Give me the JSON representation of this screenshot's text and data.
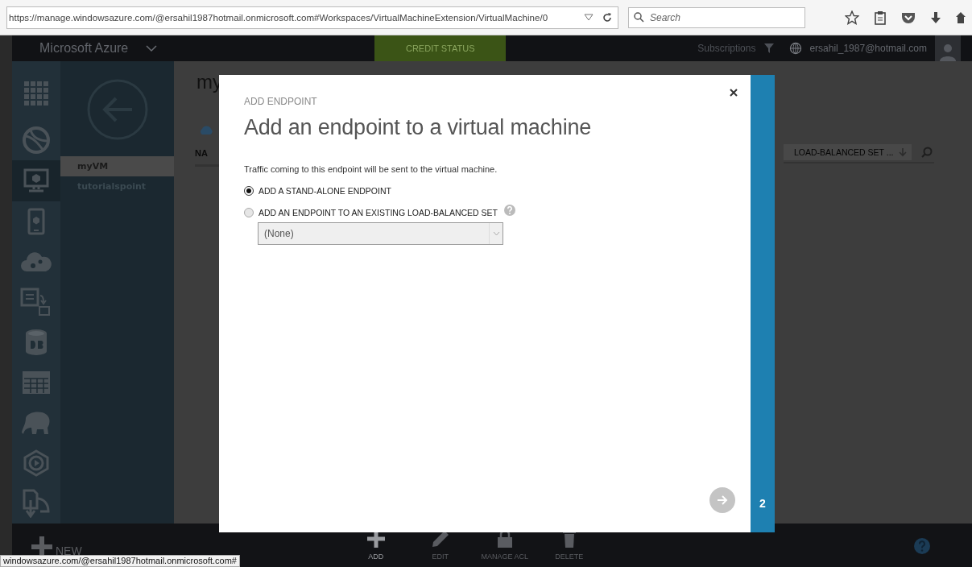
{
  "browser": {
    "url": "https://manage.windowsazure.com/@ersahil1987hotmail.onmicrosoft.com#Workspaces/VirtualMachineExtension/VirtualMachine/0",
    "search": {
      "placeholder": "Search"
    },
    "status_url": "windowsazure.com/@ersahil1987hotmail.onmicrosoft.com#"
  },
  "header": {
    "brand": "Microsoft Azure",
    "credit_status": "CREDIT STATUS",
    "subscriptions": "Subscriptions",
    "user": "ersahil_1987@hotmail.com"
  },
  "nav_rail": {
    "items": [
      {
        "kind": "grid",
        "selected": false
      },
      {
        "kind": "globe",
        "selected": false
      },
      {
        "kind": "monitor",
        "selected": true
      },
      {
        "kind": "mobile",
        "selected": false
      },
      {
        "kind": "cloud",
        "selected": false
      },
      {
        "kind": "document",
        "selected": false
      },
      {
        "kind": "database",
        "selected": false
      },
      {
        "kind": "table",
        "selected": false
      },
      {
        "kind": "elephant",
        "selected": false
      },
      {
        "kind": "media",
        "selected": false
      },
      {
        "kind": "import",
        "selected": false
      }
    ]
  },
  "nav_list": {
    "items": [
      {
        "label": "myVM",
        "selected": true
      },
      {
        "label": "tutorialspoint",
        "selected": false
      }
    ]
  },
  "content": {
    "title": "my",
    "columns": [
      "NA",
      "LOAD-BALANCED SET ..."
    ]
  },
  "dialog": {
    "eyebrow": "ADD ENDPOINT",
    "title": "Add an endpoint to a virtual machine",
    "description": "Traffic coming to this endpoint will be sent to the virtual machine.",
    "options": [
      {
        "label": "ADD A STAND-ALONE ENDPOINT",
        "selected": true,
        "help": false
      },
      {
        "label": "ADD AN ENDPOINT TO AN EXISTING LOAD-BALANCED SET",
        "selected": false,
        "help": true
      }
    ],
    "dropdown": {
      "value": "(None)",
      "disabled": true
    },
    "step": "2"
  },
  "command_bar": {
    "new": "NEW",
    "commands": [
      {
        "label": "ADD",
        "kind": "add",
        "disabled": false
      },
      {
        "label": "EDIT",
        "kind": "edit",
        "disabled": true
      },
      {
        "label": "MANAGE ACL",
        "kind": "lock",
        "disabled": true
      },
      {
        "label": "DELETE",
        "kind": "trash",
        "disabled": true
      }
    ]
  }
}
